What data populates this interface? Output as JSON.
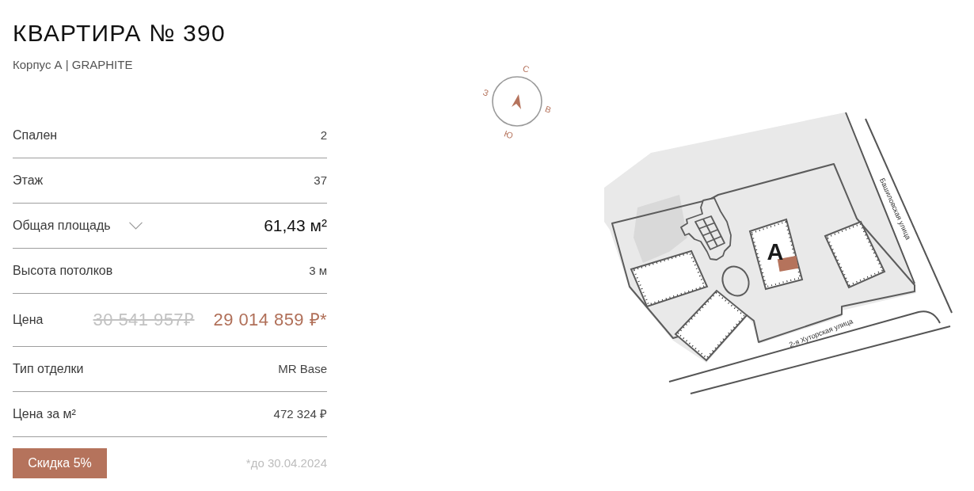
{
  "title": "КВАРТИРА № 390",
  "subtitle": "Корпус А | GRAPHITE",
  "specs": [
    {
      "kind": "plain",
      "label": "Спален",
      "value": "2"
    },
    {
      "kind": "plain",
      "label": "Этаж",
      "value": "37"
    },
    {
      "kind": "expandable",
      "label": "Общая площадь",
      "value": "61,43 м²"
    },
    {
      "kind": "plain",
      "label": "Высота потолков",
      "value": "3 м"
    },
    {
      "kind": "price",
      "label": "Цена",
      "old_value": "30 541 957₽",
      "value": "29 014 859 ₽*"
    },
    {
      "kind": "plain",
      "label": "Тип отделки",
      "value": "MR Base"
    },
    {
      "kind": "plain",
      "label": "Цена за м²",
      "value": "472 324 ₽"
    }
  ],
  "discount": {
    "badge": "Скидка 5%",
    "note": "*до 30.04.2024"
  },
  "compass": {
    "north": "С",
    "east": "В",
    "south": "Ю",
    "west": "З"
  },
  "site_plan": {
    "building_label": "А",
    "streets": [
      "Башиловская улица",
      "2-я Хуторская улица"
    ]
  }
}
